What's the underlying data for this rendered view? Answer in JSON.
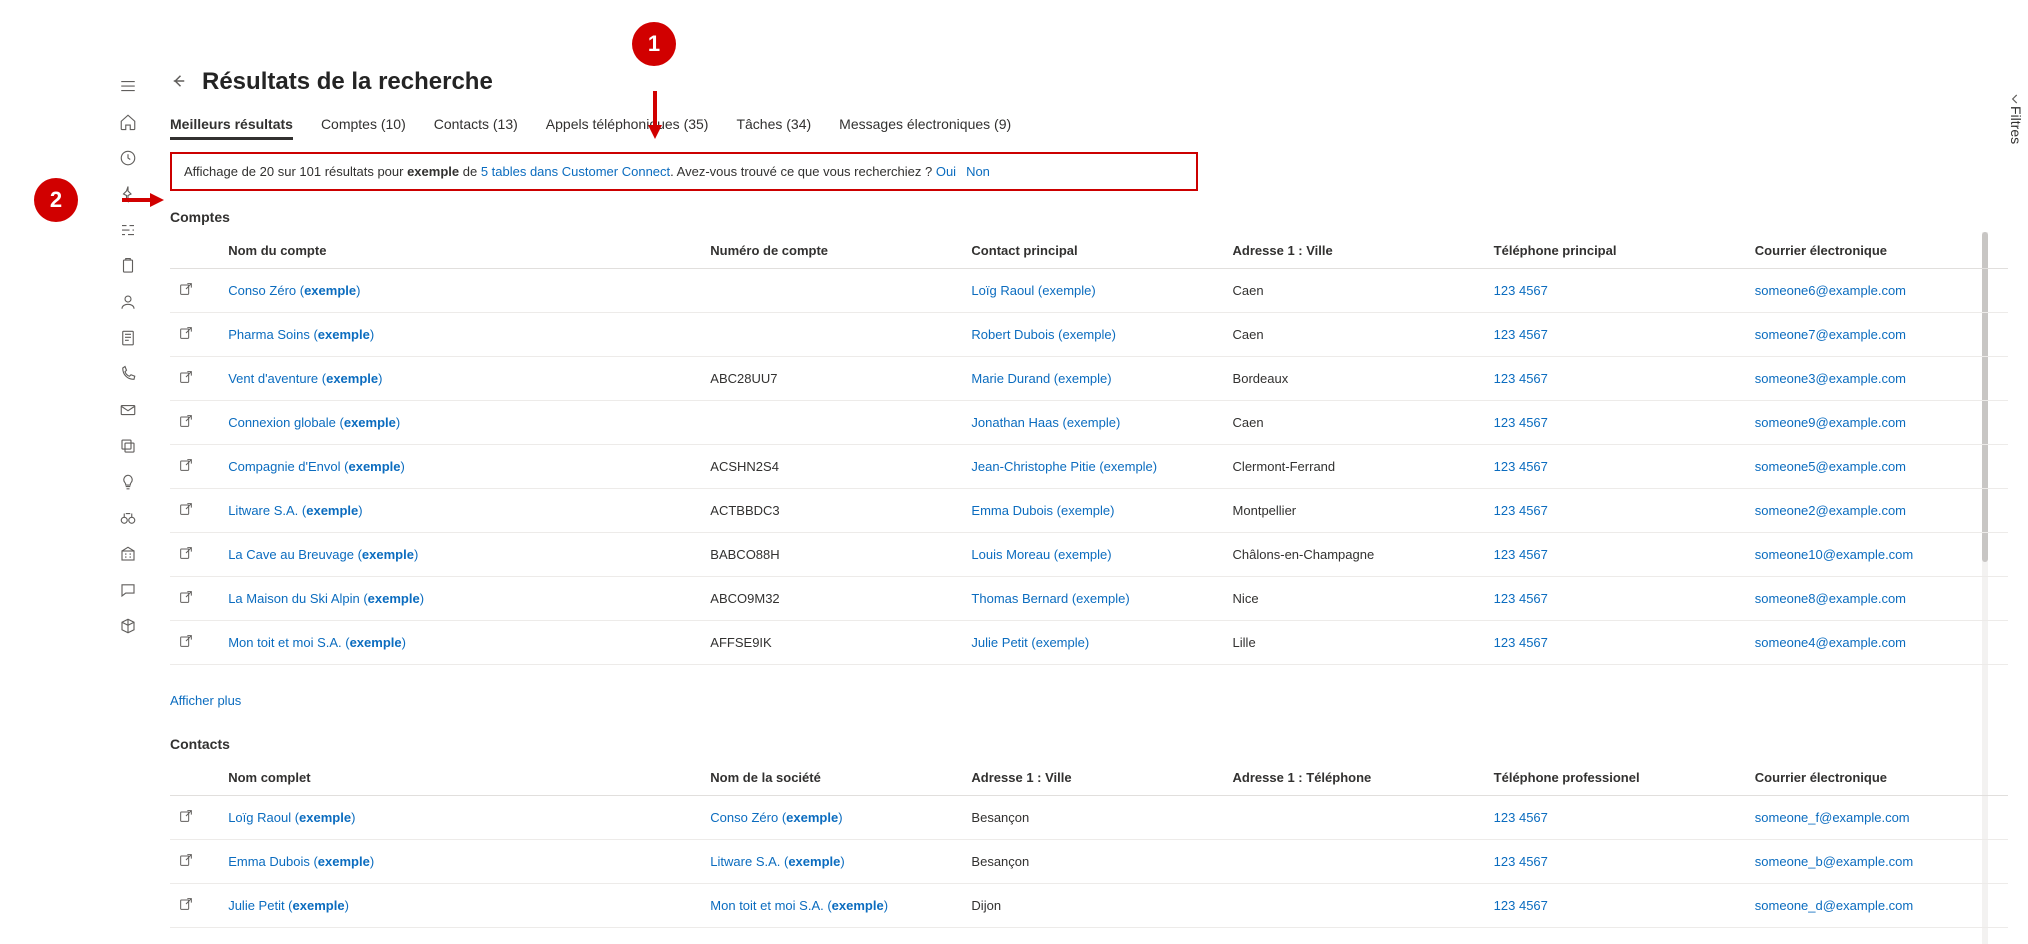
{
  "page_title": "Résultats de la recherche",
  "tabs": [
    {
      "label": "Meilleurs résultats",
      "active": true
    },
    {
      "label": "Comptes (10)"
    },
    {
      "label": "Contacts (13)"
    },
    {
      "label": "Appels téléphoniques (35)"
    },
    {
      "label": "Tâches (34)"
    },
    {
      "label": "Messages électroniques (9)"
    }
  ],
  "feedback": {
    "prefix": "Affichage de 20 sur 101 résultats pour ",
    "term": "exemple",
    "mid1": " de ",
    "tables_link": "5 tables dans Customer Connect",
    "mid2": ". Avez-vous trouvé ce que vous recherchiez ? ",
    "yes": "Oui",
    "no": "Non"
  },
  "annotations": {
    "one": "1",
    "two": "2"
  },
  "filters_label": "Filtres",
  "sections": {
    "accounts": {
      "title": "Comptes",
      "headers": [
        "Nom du compte",
        "Numéro de compte",
        "Contact principal",
        "Adresse 1 : Ville",
        "Téléphone principal",
        "Courrier électronique"
      ],
      "rows": [
        {
          "name": "Conso Zéro",
          "num": "",
          "contact": "Loïg Raoul (exemple)",
          "city": "Caen",
          "phone": "123 4567",
          "email": "someone6@example.com"
        },
        {
          "name": "Pharma Soins",
          "num": "",
          "contact": "Robert Dubois (exemple)",
          "city": "Caen",
          "phone": "123 4567",
          "email": "someone7@example.com"
        },
        {
          "name": "Vent d'aventure",
          "num": "ABC28UU7",
          "contact": "Marie Durand (exemple)",
          "city": "Bordeaux",
          "phone": "123 4567",
          "email": "someone3@example.com"
        },
        {
          "name": "Connexion globale",
          "num": "",
          "contact": "Jonathan Haas (exemple)",
          "city": "Caen",
          "phone": "123 4567",
          "email": "someone9@example.com"
        },
        {
          "name": "Compagnie d'Envol",
          "num": "ACSHN2S4",
          "contact": "Jean-Christophe Pitie (exemple)",
          "city": "Clermont-Ferrand",
          "phone": "123 4567",
          "email": "someone5@example.com"
        },
        {
          "name": "Litware S.A.",
          "num": "ACTBBDC3",
          "contact": "Emma Dubois (exemple)",
          "city": "Montpellier",
          "phone": "123 4567",
          "email": "someone2@example.com"
        },
        {
          "name": "La Cave au Breuvage",
          "num": "BABCO88H",
          "contact": "Louis Moreau (exemple)",
          "city": "Châlons-en-Champagne",
          "phone": "123 4567",
          "email": "someone10@example.com"
        },
        {
          "name": "La Maison du Ski Alpin",
          "num": "ABCO9M32",
          "contact": "Thomas Bernard (exemple)",
          "city": "Nice",
          "phone": "123 4567",
          "email": "someone8@example.com"
        },
        {
          "name": "Mon toit et moi S.A.",
          "num": "AFFSE9IK",
          "contact": "Julie Petit (exemple)",
          "city": "Lille",
          "phone": "123 4567",
          "email": "someone4@example.com"
        }
      ],
      "show_more": "Afficher plus"
    },
    "contacts": {
      "title": "Contacts",
      "headers": [
        "Nom complet",
        "Nom de la société",
        "Adresse 1 : Ville",
        "Adresse 1 : Téléphone",
        "Téléphone professionel",
        "Courrier électronique"
      ],
      "rows": [
        {
          "name": "Loïg Raoul",
          "company": "Conso Zéro",
          "city": "Besançon",
          "addrphone": "",
          "phone": "123 4567",
          "email": "someone_f@example.com"
        },
        {
          "name": "Emma Dubois",
          "company": "Litware S.A.",
          "city": "Besançon",
          "addrphone": "",
          "phone": "123 4567",
          "email": "someone_b@example.com"
        },
        {
          "name": "Julie Petit",
          "company": "Mon toit et moi S.A.",
          "city": "Dijon",
          "addrphone": "",
          "phone": "123 4567",
          "email": "someone_d@example.com"
        }
      ]
    }
  }
}
